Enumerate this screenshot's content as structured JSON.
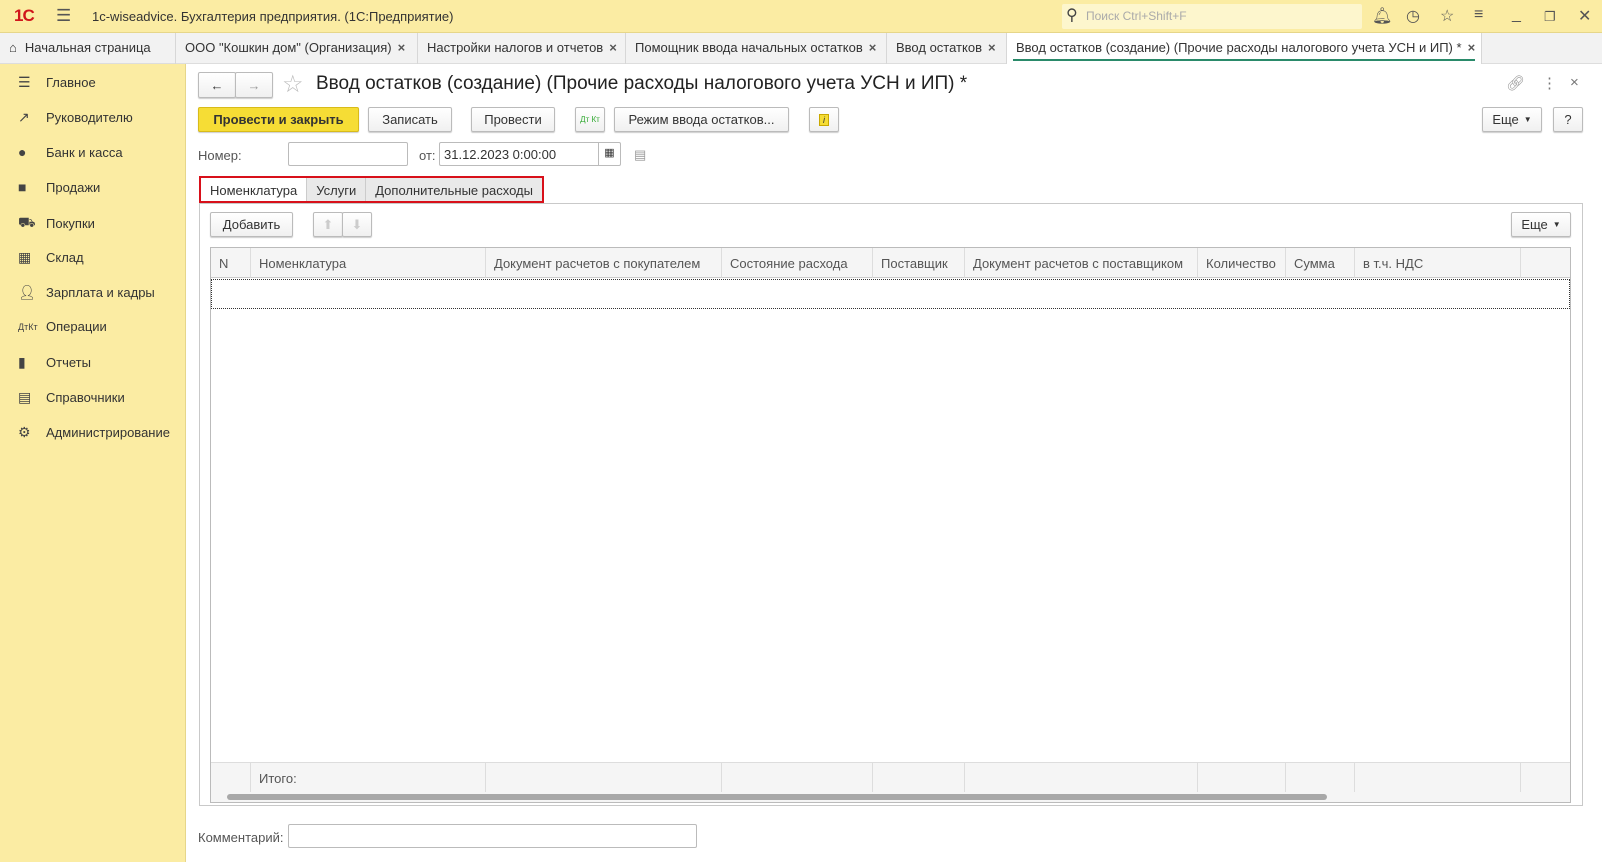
{
  "titlebar": {
    "logo": "1С",
    "title": "1c-wiseadvice. Бухгалтерия предприятия.  (1С:Предприятие)",
    "search_placeholder": "Поиск Ctrl+Shift+F"
  },
  "tabs": [
    {
      "label": "Начальная страница"
    },
    {
      "label": "ООО \"Кошкин дом\" (Организация)"
    },
    {
      "label": "Настройки налогов и отчетов"
    },
    {
      "label": "Помощник ввода начальных остатков"
    },
    {
      "label": "Ввод остатков"
    },
    {
      "label": "Ввод остатков (создание) (Прочие расходы налогового учета УСН и ИП) *"
    }
  ],
  "sidebar": [
    "Главное",
    "Руководителю",
    "Банк и касса",
    "Продажи",
    "Покупки",
    "Склад",
    "Зарплата и кадры",
    "Операции",
    "Отчеты",
    "Справочники",
    "Администрирование"
  ],
  "form": {
    "title": "Ввод остатков (создание) (Прочие расходы налогового учета УСН и ИП) *",
    "post_close": "Провести и закрыть",
    "save": "Записать",
    "post": "Провести",
    "dtkt": "Дт Кт",
    "mode": "Режим ввода остатков...",
    "more": "Еще",
    "help": "?",
    "number_label": "Номер:",
    "number_value": "",
    "date_label": "от:",
    "date_value": "31.12.2023  0:00:00",
    "comment_label": "Комментарий:",
    "comment_value": ""
  },
  "form_tabs": [
    "Номенклатура",
    "Услуги",
    "Дополнительные расходы"
  ],
  "table": {
    "add": "Добавить",
    "more": "Еще",
    "columns": [
      "N",
      "Номенклатура",
      "Документ расчетов с покупателем",
      "Состояние расхода",
      "Поставщик",
      "Документ расчетов с поставщиком",
      "Количество",
      "Сумма",
      "в т.ч. НДС",
      ""
    ],
    "total_label": "Итого:"
  },
  "colors": {
    "accent": "#f6dd35",
    "panel": "#fbeca3",
    "highlight": "#d8101a"
  }
}
